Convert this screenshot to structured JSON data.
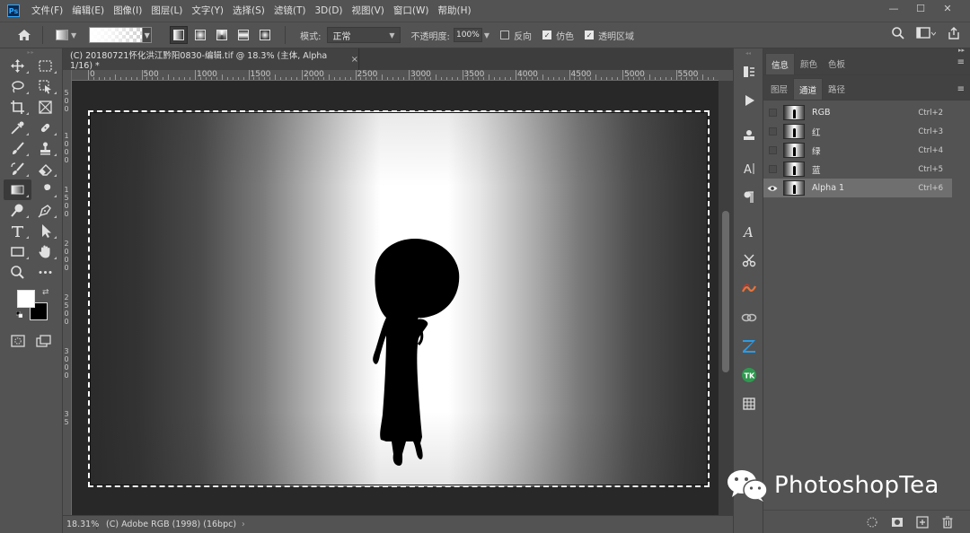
{
  "app": {
    "logo": "Ps",
    "menu": [
      "文件(F)",
      "编辑(E)",
      "图像(I)",
      "图层(L)",
      "文字(Y)",
      "选择(S)",
      "滤镜(T)",
      "3D(D)",
      "视图(V)",
      "窗口(W)",
      "帮助(H)"
    ]
  },
  "window_controls": {
    "minimize": "—",
    "maximize": "☐",
    "close": "✕"
  },
  "options_bar": {
    "mode_label": "模式:",
    "mode_value": "正常",
    "opacity_label": "不透明度:",
    "opacity_value": "100%",
    "reverse_label": "反向",
    "dither_label": "仿色",
    "transparency_label": "透明区域",
    "reverse_checked": false,
    "dither_checked": true,
    "transparency_checked": true
  },
  "document": {
    "tab_title": "(C) 20180721怀化洪江黔阳0830-编辑.tif @ 18.3% (主体, Alpha 1/16) *",
    "tab_close": "×"
  },
  "ruler": {
    "h_labels": [
      "0",
      "500",
      "1000",
      "1500",
      "2000",
      "2500",
      "3000",
      "3500",
      "4000",
      "4500",
      "5000",
      "5500"
    ],
    "v_labels": [
      "5",
      "0",
      "0",
      "1",
      "0",
      "0",
      "0",
      "1",
      "5",
      "0",
      "0",
      "2",
      "0",
      "0",
      "0",
      "2",
      "5",
      "0",
      "0",
      "3",
      "0",
      "0",
      "0",
      "3",
      "5"
    ]
  },
  "status": {
    "zoom": "18.31%",
    "profile": "(C) Adobe RGB (1998) (16bpc)",
    "arrow": "›"
  },
  "panels": {
    "upper_tabs": [
      "信息",
      "颜色",
      "色板"
    ],
    "upper_active": 0,
    "lower_tabs": [
      "图层",
      "通道",
      "路径"
    ],
    "lower_active": 1,
    "channels": [
      {
        "name": "RGB",
        "shortcut": "Ctrl+2",
        "visible": false,
        "selected": false
      },
      {
        "name": "红",
        "shortcut": "Ctrl+3",
        "visible": false,
        "selected": false
      },
      {
        "name": "绿",
        "shortcut": "Ctrl+4",
        "visible": false,
        "selected": false
      },
      {
        "name": "蓝",
        "shortcut": "Ctrl+5",
        "visible": false,
        "selected": false
      },
      {
        "name": "Alpha 1",
        "shortcut": "Ctrl+6",
        "visible": true,
        "selected": true
      }
    ]
  },
  "watermark": {
    "text": "PhotoshopTea"
  },
  "colors": {
    "chrome": "#535353",
    "canvas_bg": "#282828",
    "foreground": "#ffffff",
    "background": "#000000",
    "selected_row": "#6f6f6f"
  }
}
